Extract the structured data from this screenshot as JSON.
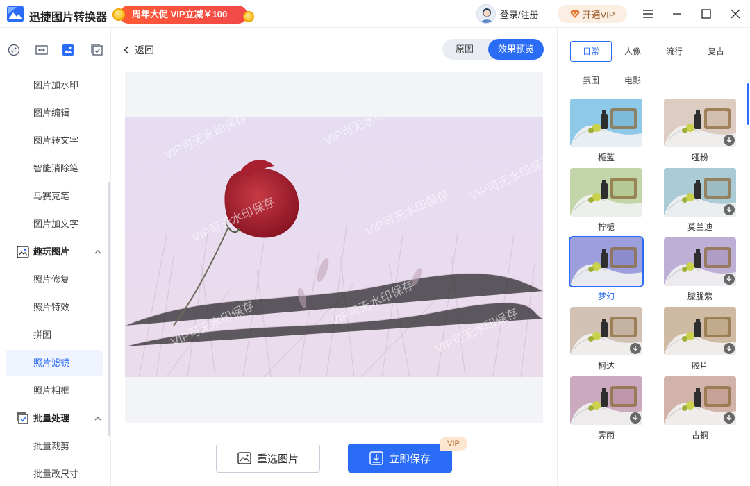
{
  "app": {
    "title": "迅捷图片转换器",
    "promo": "周年大促 VIP立减￥100",
    "login": "登录/注册",
    "vip_button": "开通VIP"
  },
  "sidebar": {
    "items": [
      {
        "label": "图片加水印"
      },
      {
        "label": "图片编辑"
      },
      {
        "label": "图片转文字"
      },
      {
        "label": "智能消除笔"
      },
      {
        "label": "马赛克笔"
      },
      {
        "label": "图片加文字"
      }
    ],
    "group_fun": {
      "label": "趣玩图片"
    },
    "fun_items": [
      {
        "label": "照片修复"
      },
      {
        "label": "照片特效"
      },
      {
        "label": "拼图"
      },
      {
        "label": "照片滤镜",
        "active": true
      },
      {
        "label": "照片相框"
      }
    ],
    "group_batch": {
      "label": "批量处理"
    },
    "batch_items": [
      {
        "label": "批量裁剪"
      },
      {
        "label": "批量改尺寸"
      }
    ]
  },
  "main": {
    "back": "返回",
    "toggle_original": "原图",
    "toggle_preview": "效果预览",
    "watermark": "VIP可无水印保存",
    "reselect": "重选图片",
    "save": "立即保存",
    "vip_badge": "VIP"
  },
  "filters": {
    "categories": [
      "日常",
      "人像",
      "流行",
      "复古",
      "氛围",
      "电影"
    ],
    "active_category": "日常",
    "items": [
      {
        "label": "栀蓝",
        "tint": "#7cc0e6",
        "download": false
      },
      {
        "label": "哑粉",
        "tint": "#d7c4b8",
        "download": true
      },
      {
        "label": "柠栀",
        "tint": "#b9cf9a",
        "download": false
      },
      {
        "label": "莫兰迪",
        "tint": "#9dc2cf",
        "download": true
      },
      {
        "label": "梦幻",
        "tint": "#8c8fd6",
        "download": false,
        "selected": true
      },
      {
        "label": "朦胧紫",
        "tint": "#b3a1cf",
        "download": true
      },
      {
        "label": "柯达",
        "tint": "#c9b8a8",
        "download": true
      },
      {
        "label": "胶片",
        "tint": "#c7b093",
        "download": true
      },
      {
        "label": "霁雨",
        "tint": "#c29ab3",
        "download": true
      },
      {
        "label": "古铜",
        "tint": "#caa69c",
        "download": true
      }
    ]
  },
  "colors": {
    "accent": "#2a6cf5",
    "promo_red": "#f24848",
    "vip_bg": "#fbeee2"
  }
}
